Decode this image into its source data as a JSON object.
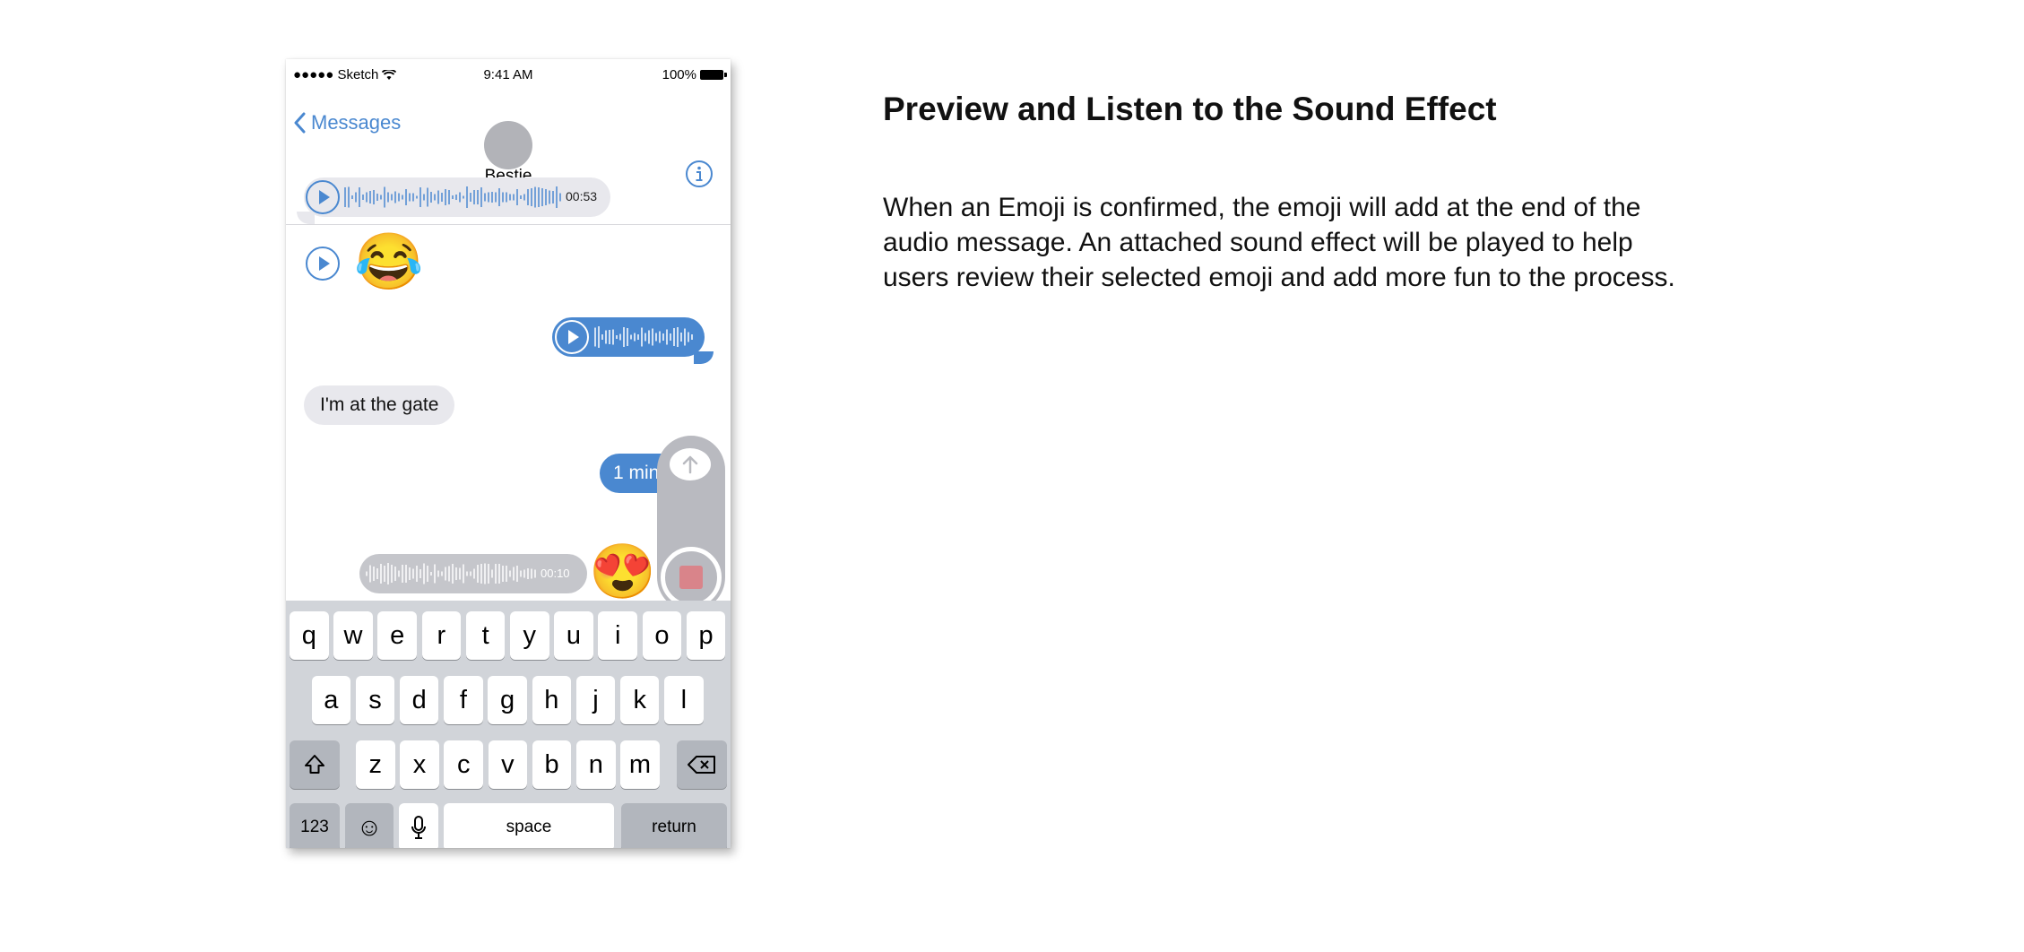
{
  "status_bar": {
    "carrier": "●●●●● Sketch",
    "time": "9:41 AM",
    "battery": "100%"
  },
  "nav": {
    "back_label": "Messages",
    "contact_name": "Bestie"
  },
  "messages": {
    "incoming_audio_duration": "00:53",
    "incoming_text": "I'm at the gate",
    "outgoing_text": "1 min",
    "draft_audio_duration": "00:10"
  },
  "emojis": {
    "laughing": "😂",
    "heart_eyes": "😍",
    "smiley_key": "☺"
  },
  "keyboard": {
    "row1": [
      "q",
      "w",
      "e",
      "r",
      "t",
      "y",
      "u",
      "i",
      "o",
      "p"
    ],
    "row2": [
      "a",
      "s",
      "d",
      "f",
      "g",
      "h",
      "j",
      "k",
      "l"
    ],
    "row3": [
      "z",
      "x",
      "c",
      "v",
      "b",
      "n",
      "m"
    ],
    "numbers": "123",
    "space": "space",
    "return": "return"
  },
  "annotation": {
    "title": "Preview and Listen to the Sound Effect",
    "body_lines": [
      "When an Emoji is confirmed, the emoji will add at the end of the",
      "audio message. An attached sound effect will be played to help",
      "users review their selected emoji and add more fun to the process."
    ]
  },
  "colors": {
    "accent_blue": "#4a88d0",
    "incoming_bubble": "#e8e8ed",
    "record_square": "#d9848a"
  },
  "icons": [
    "wifi-icon",
    "battery-icon",
    "chevron-left-icon",
    "info-icon",
    "play-icon",
    "waveform-icon",
    "send-arrow-icon",
    "stop-record-icon",
    "shift-icon",
    "delete-icon",
    "emoji-icon",
    "microphone-icon"
  ]
}
